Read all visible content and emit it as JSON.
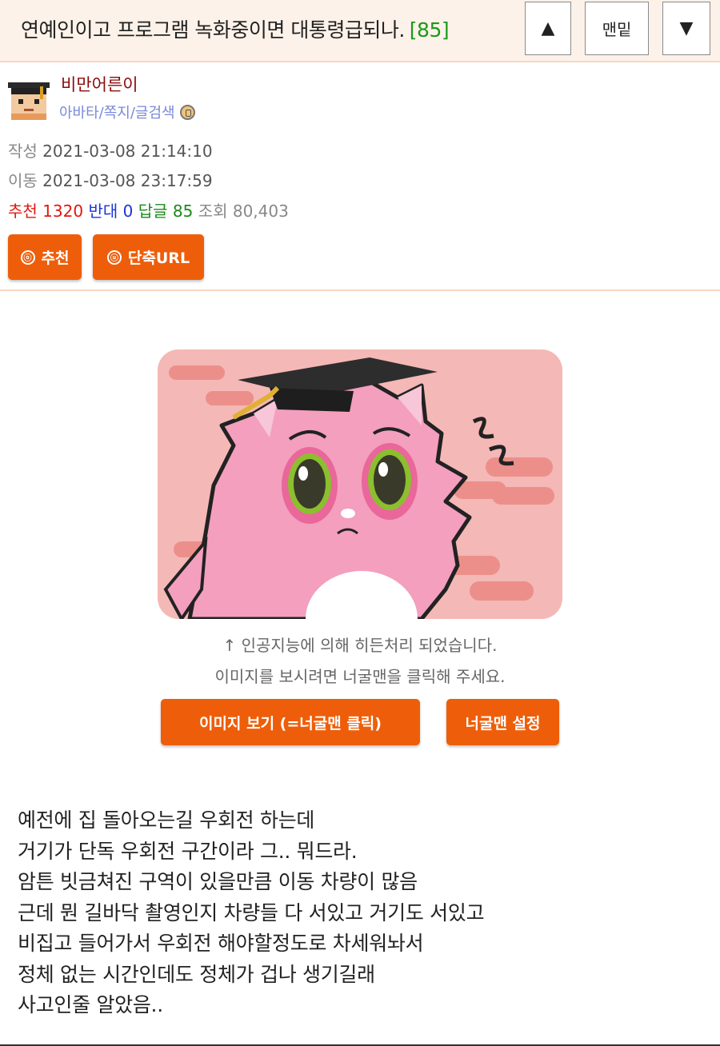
{
  "header": {
    "title": "연예인이고 프로그램 녹화중이면 대통령급되나.",
    "reply_count": "[85]",
    "up_icon": "triangle-up",
    "bottom_label": "맨밑",
    "down_icon": "triangle-down"
  },
  "author": {
    "name": "비만어른이",
    "links": "아바타/쪽지/글검색",
    "avatar_icon": "graduate-avatar-icon",
    "badge_icon": "level-badge-icon"
  },
  "meta": {
    "written_label": "작성",
    "written_value": "2021-03-08 21:14:10",
    "moved_label": "이동",
    "moved_value": "2021-03-08 23:17:59",
    "recommend_label": "추천",
    "recommend_value": "1320",
    "oppose_label": "반대",
    "oppose_value": "0",
    "reply_label": "답글",
    "reply_value": "85",
    "views_label": "조회",
    "views_value": "80,403"
  },
  "actions": {
    "recommend_button": "추천",
    "recommend_glyph": "ⓞ",
    "shorturl_button": "단축URL",
    "shorturl_glyph": "ⓤ"
  },
  "image_notice": {
    "line1": "↑ 인공지능에 의해 히든처리 되었습니다.",
    "line2": "이미지를 보시려면 너굴맨을 클릭해 주세요.",
    "view_button": "이미지 보기 (=너굴맨 클릭)",
    "setting_button": "너굴맨 설정"
  },
  "content": {
    "lines": [
      "예전에 집 돌아오는길 우회전 하는데",
      "거기가 단독 우회전 구간이라 그.. 뭐드라.",
      "암튼 빗금쳐진 구역이 있을만큼 이동 차량이 많음",
      "근데 뭔 길바닥 촬영인지 차량들 다 서있고 거기도 서있고",
      "비집고 들어가서 우회전 해야할정도로 차세워놔서",
      "정체 없는 시간인데도 정체가 겁나 생기길래",
      "사고인줄 알았음.."
    ]
  },
  "colors": {
    "header_bg": "#fdf2e9",
    "accent_orange": "#ee5e0a",
    "recommend_red": "#e0180f",
    "oppose_blue": "#1a35d8",
    "reply_green": "#1a8a1a",
    "author_name": "#8b0a0a",
    "link_color": "#7a8ad8"
  }
}
